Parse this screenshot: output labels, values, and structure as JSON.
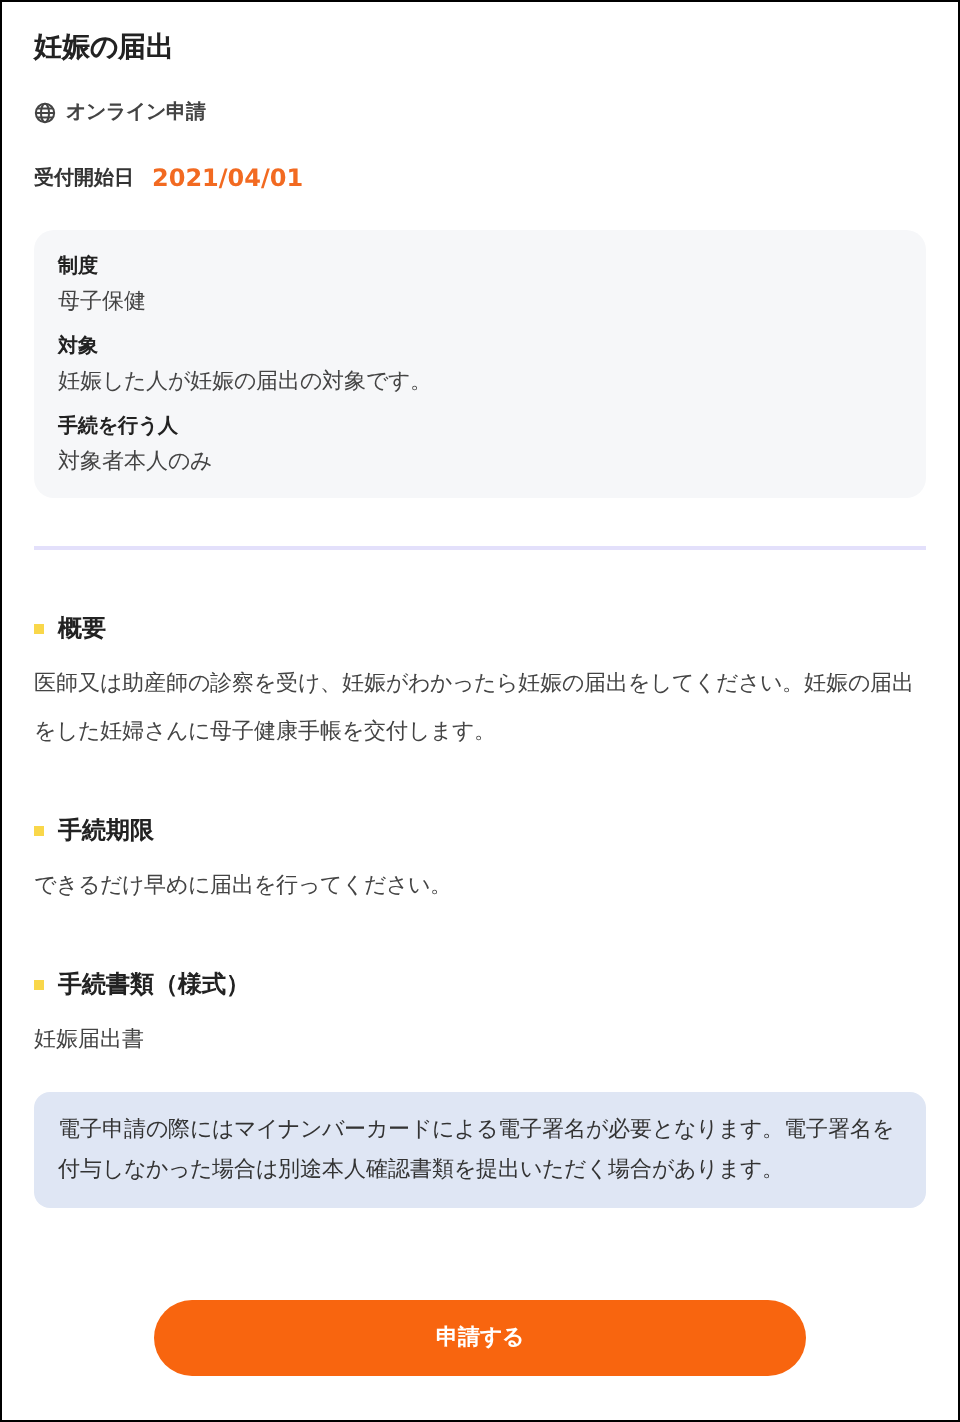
{
  "title": "妊娠の届出",
  "application_method": "オンライン申請",
  "start_date": {
    "label": "受付開始日",
    "value": "2021/04/01"
  },
  "info": [
    {
      "label": "制度",
      "value": "母子保健"
    },
    {
      "label": "対象",
      "value": "妊娠した人が妊娠の届出の対象です。"
    },
    {
      "label": "手続を行う人",
      "value": "対象者本人のみ"
    }
  ],
  "sections": [
    {
      "heading": "概要",
      "body": "医師又は助産師の診察を受け、妊娠がわかったら妊娠の届出をしてください。妊娠の届出をした妊婦さんに母子健康手帳を交付します。"
    },
    {
      "heading": "手続期限",
      "body": "できるだけ早めに届出を行ってください。"
    },
    {
      "heading": "手続書類（様式）",
      "body": "妊娠届出書"
    }
  ],
  "notice": "電子申請の際にはマイナンバーカードによる電子署名が必要となります。電子署名を付与しなかった場合は別途本人確認書類を提出いただく場合があります。",
  "submit_button": "申請する"
}
